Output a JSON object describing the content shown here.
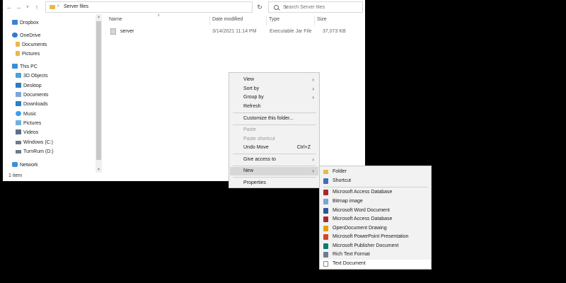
{
  "address_bar": {
    "path": "Server files",
    "search_placeholder": "Search Server files"
  },
  "nav_pane": {
    "items": [
      {
        "label": "Dropbox",
        "icon": "dropbox-icon"
      },
      {
        "label": "OneDrive",
        "icon": "cloud-icon"
      },
      {
        "label": "Documents",
        "icon": "folder-icon"
      },
      {
        "label": "Pictures",
        "icon": "folder-icon"
      },
      {
        "label": "This PC",
        "icon": "computer-icon"
      },
      {
        "label": "3D Objects",
        "icon": "cube-icon"
      },
      {
        "label": "Desktop",
        "icon": "desktop-icon"
      },
      {
        "label": "Documents",
        "icon": "documents-icon"
      },
      {
        "label": "Downloads",
        "icon": "download-icon"
      },
      {
        "label": "Music",
        "icon": "music-note-icon"
      },
      {
        "label": "Pictures",
        "icon": "pictures-icon"
      },
      {
        "label": "Videos",
        "icon": "videos-icon"
      },
      {
        "label": "Windows (C:)",
        "icon": "drive-icon"
      },
      {
        "label": "TurnRum (D:)",
        "icon": "drive-icon"
      },
      {
        "label": "Network",
        "icon": "network-icon"
      }
    ]
  },
  "columns": {
    "name": "Name",
    "date": "Date modified",
    "type": "Type",
    "size": "Size"
  },
  "files": [
    {
      "name": "server",
      "date": "3/14/2021 11:14 PM",
      "type": "Executable Jar File",
      "size": "37,073 KB"
    }
  ],
  "status": {
    "count": "1 item"
  },
  "context_menu": {
    "view": "View",
    "sort_by": "Sort by",
    "group_by": "Group by",
    "refresh": "Refresh",
    "customize": "Customize this folder...",
    "paste": "Paste",
    "paste_shortcut": "Paste shortcut",
    "undo_move": "Undo Move",
    "undo_shortcut": "Ctrl+Z",
    "give_access": "Give access to",
    "new": "New",
    "properties": "Properties"
  },
  "new_submenu": {
    "items": [
      {
        "label": "Folder",
        "icon": "folder-icon"
      },
      {
        "label": "Shortcut",
        "icon": "shortcut-icon"
      },
      {
        "label": "Microsoft Access Database",
        "icon": "access-icon"
      },
      {
        "label": "Bitmap image",
        "icon": "bitmap-icon"
      },
      {
        "label": "Microsoft Word Document",
        "icon": "word-icon"
      },
      {
        "label": "Microsoft Access Database",
        "icon": "access-icon"
      },
      {
        "label": "OpenDocument Drawing",
        "icon": "drawing-icon"
      },
      {
        "label": "Microsoft PowerPoint Presentation",
        "icon": "powerpoint-icon"
      },
      {
        "label": "Microsoft Publisher Document",
        "icon": "publisher-icon"
      },
      {
        "label": "Rich Text Format",
        "icon": "rtf-icon"
      },
      {
        "label": "Text Document",
        "icon": "text-document-icon"
      }
    ]
  }
}
